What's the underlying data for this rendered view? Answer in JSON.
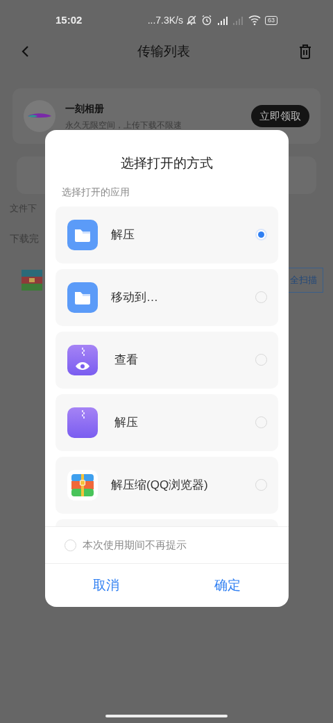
{
  "status_bar": {
    "time": "15:02",
    "speed": "...7.3K/s",
    "battery": "63"
  },
  "header": {
    "title": "传输列表"
  },
  "promo": {
    "name": "一刻相册",
    "desc": "永久无限空间，上传下载不限速",
    "button": "立即领取"
  },
  "section_label": "文件下",
  "downloaded_label": "下载完",
  "scan_button": "全扫描",
  "dialog": {
    "title": "选择打开的方式",
    "subtitle": "选择打开的应用",
    "apps": [
      {
        "kind": "folder",
        "label": "解压",
        "selected": true
      },
      {
        "kind": "folder",
        "label": "移动到…",
        "selected": false
      },
      {
        "kind": "viewer",
        "label": "查看",
        "selected": false
      },
      {
        "kind": "archive",
        "label": "解压",
        "selected": false
      },
      {
        "kind": "qq",
        "label": "解压缩(QQ浏览器)",
        "selected": false
      }
    ],
    "remember": {
      "label": "本次使用期间不再提示",
      "checked": false
    },
    "buttons": [
      "取消",
      "确定"
    ]
  }
}
